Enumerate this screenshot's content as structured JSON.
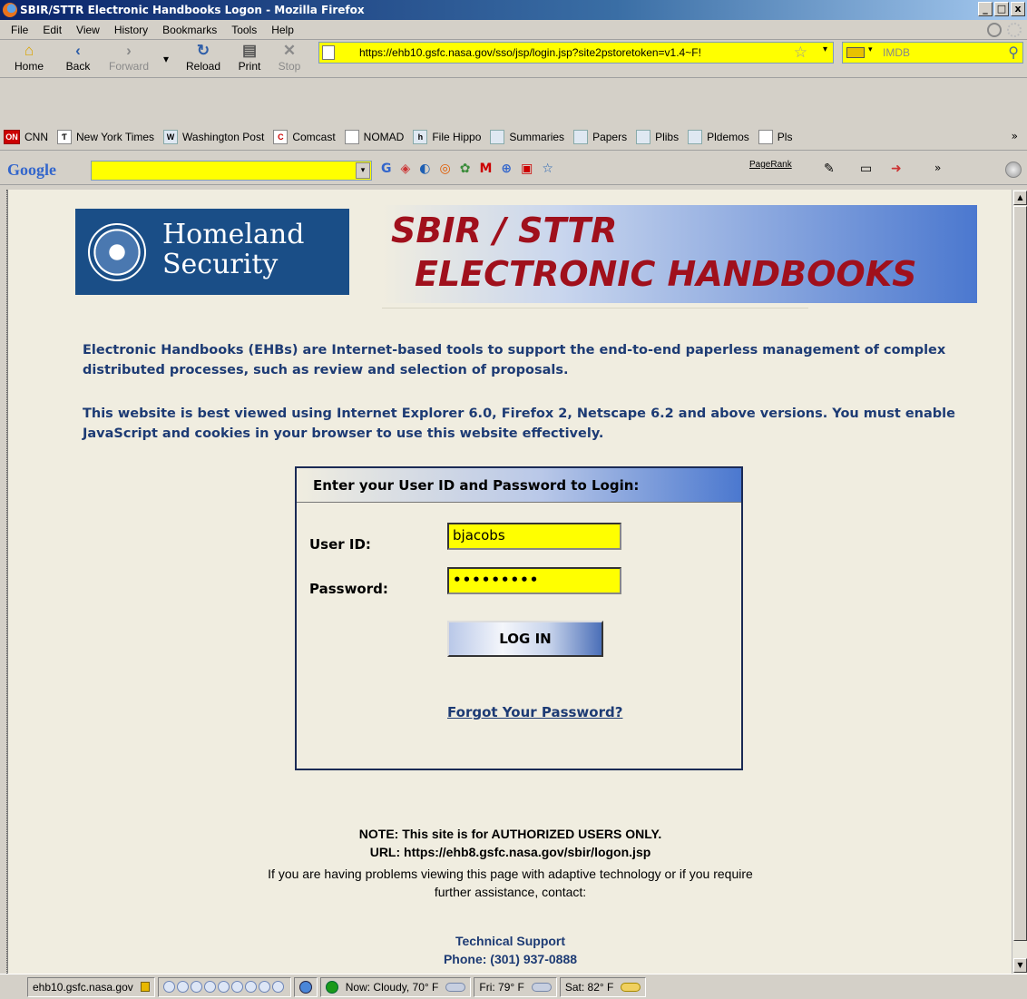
{
  "window": {
    "title": "SBIR/STTR Electronic Handbooks Logon - Mozilla Firefox",
    "controls": [
      "_",
      "□",
      "x"
    ]
  },
  "menu": [
    "File",
    "Edit",
    "View",
    "History",
    "Bookmarks",
    "Tools",
    "Help"
  ],
  "nav": {
    "home": "Home",
    "back": "Back",
    "forward": "Forward",
    "reload": "Reload",
    "print": "Print",
    "stop": "Stop",
    "url": "https://ehb10.gsfc.nasa.gov/sso/jsp/login.jsp?site2pstoretoken=v1.4~F!",
    "search_engine_placeholder": "IMDB"
  },
  "bookmarks": [
    "CNN",
    "New York Times",
    "Washington Post",
    "Comcast",
    "NOMAD",
    "File Hippo",
    "Summaries",
    "Papers",
    "Plibs",
    "Pldemos",
    "Pls"
  ],
  "bookmark_overflow": "»",
  "google_toolbar": {
    "logo": "Google",
    "search_value": "",
    "pagerank_label": "PageRank",
    "overflow": "»"
  },
  "page": {
    "dhs_logo_text_line1": "Homeland",
    "dhs_logo_text_line2": "Security",
    "banner_line1": "SBIR / STTR",
    "banner_line2": "ELECTRONIC HANDBOOKS",
    "intro_paragraph_1": "Electronic Handbooks (EHBs) are Internet-based tools to support the end-to-end paperless management of complex distributed processes, such as review and selection of proposals.",
    "intro_paragraph_2": "This website is best viewed using Internet Explorer 6.0, Firefox 2, Netscape 6.2 and above versions. You must enable JavaScript and cookies in your browser to use this website effectively.",
    "login": {
      "header": "Enter your User ID and Password to Login:",
      "user_id_label": "User ID:",
      "user_id_value": "bjacobs",
      "password_label": "Password:",
      "password_value": "•••••••••",
      "login_button": "LOG IN",
      "forgot_link": "Forgot Your Password?"
    },
    "note_1": "NOTE: This site is for AUTHORIZED USERS ONLY.",
    "note_2": "URL: https://ehb8.gsfc.nasa.gov/sbir/logon.jsp",
    "note_3": "If you are having problems viewing this page with adaptive technology or if you require",
    "note_4": "further assistance, contact:",
    "support_title": "Technical Support",
    "support_phone": "Phone: (301) 937-0888"
  },
  "status": {
    "domain": "ehb10.gsfc.nasa.gov",
    "weather_now": "Now: Cloudy, 70° F",
    "weather_fri": "Fri: 79° F",
    "weather_sat": "Sat: 82° F"
  },
  "colors": {
    "page_bg": "#f0ede0",
    "heading_blue": "#1d3b74",
    "banner_red": "#a0101c",
    "field_yellow": "#ffff00"
  }
}
